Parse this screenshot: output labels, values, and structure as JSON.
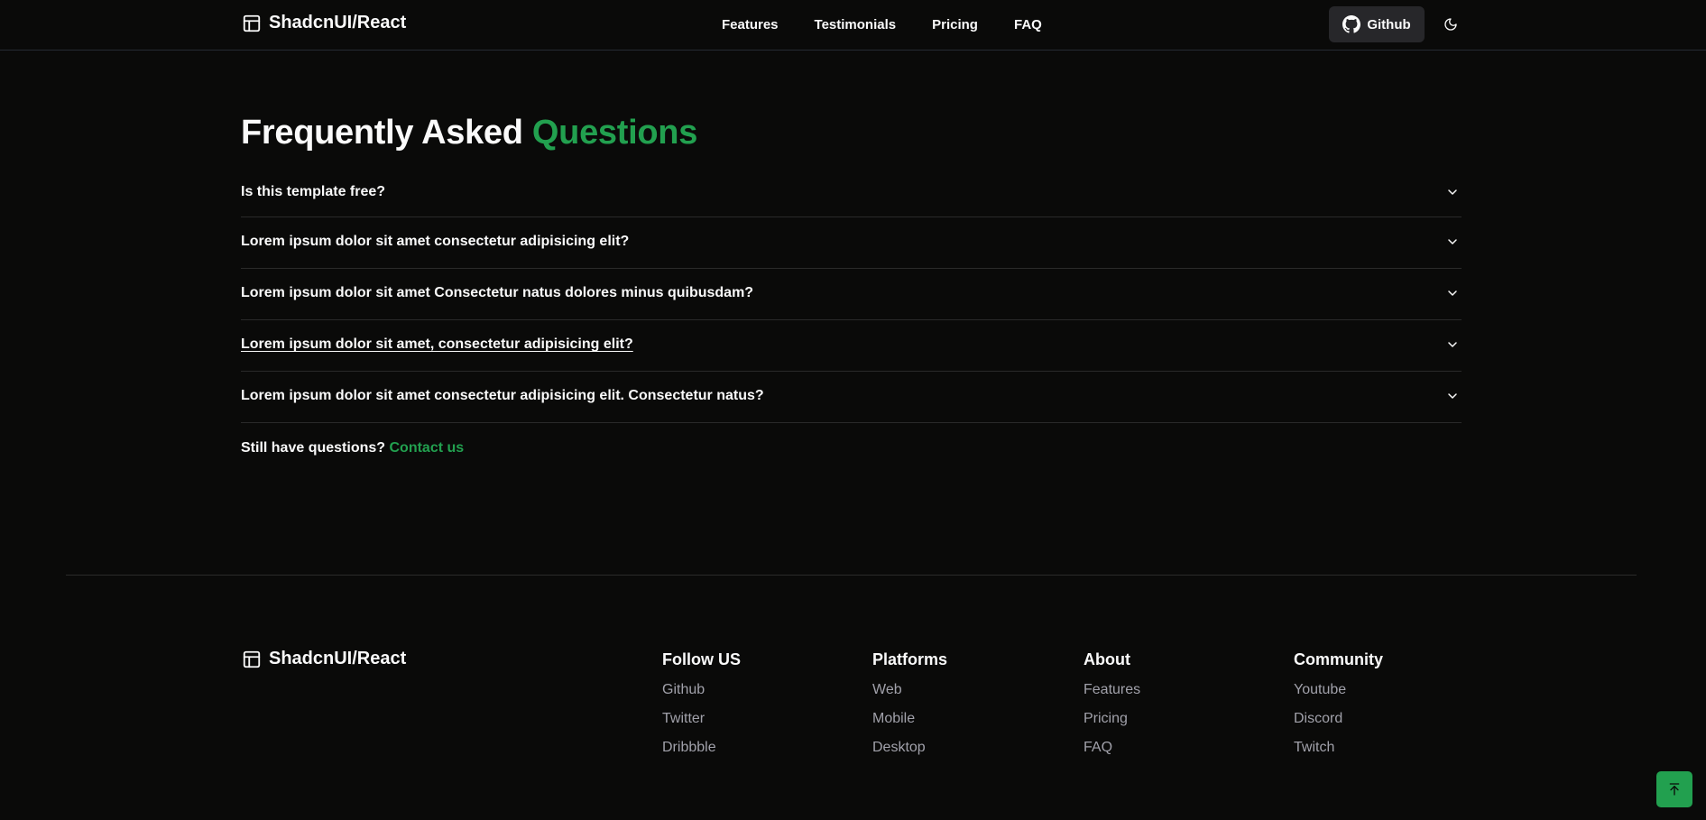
{
  "nav": {
    "brand": "ShadcnUI/React",
    "links": [
      "Features",
      "Testimonials",
      "Pricing",
      "FAQ"
    ],
    "github_label": "Github"
  },
  "faq": {
    "title_main": "Frequently Asked",
    "title_accent": "Questions",
    "items": [
      "Is this template free?",
      "Lorem ipsum dolor sit amet consectetur adipisicing elit?",
      "Lorem ipsum dolor sit amet Consectetur natus dolores minus quibusdam?",
      "Lorem ipsum dolor sit amet, consectetur adipisicing elit?",
      "Lorem ipsum dolor sit amet consectetur adipisicing elit. Consectetur natus?"
    ],
    "still_question": "Still have questions?",
    "contact_label": "Contact us"
  },
  "footer": {
    "brand": "ShadcnUI/React",
    "columns": [
      {
        "heading": "Follow US",
        "links": [
          "Github",
          "Twitter",
          "Dribbble"
        ]
      },
      {
        "heading": "Platforms",
        "links": [
          "Web",
          "Mobile",
          "Desktop"
        ]
      },
      {
        "heading": "About",
        "links": [
          "Features",
          "Pricing",
          "FAQ"
        ]
      },
      {
        "heading": "Community",
        "links": [
          "Youtube",
          "Discord",
          "Twitch"
        ]
      }
    ]
  },
  "colors": {
    "background": "#0a0a09",
    "accent": "#22a04f",
    "muted_text": "#a1a1aa"
  },
  "icons": {
    "logo": "panel-layout-icon",
    "github": "github-icon",
    "theme": "moon-icon",
    "chevron": "chevron-down-icon",
    "scroll_top": "arrow-up-to-line-icon"
  }
}
